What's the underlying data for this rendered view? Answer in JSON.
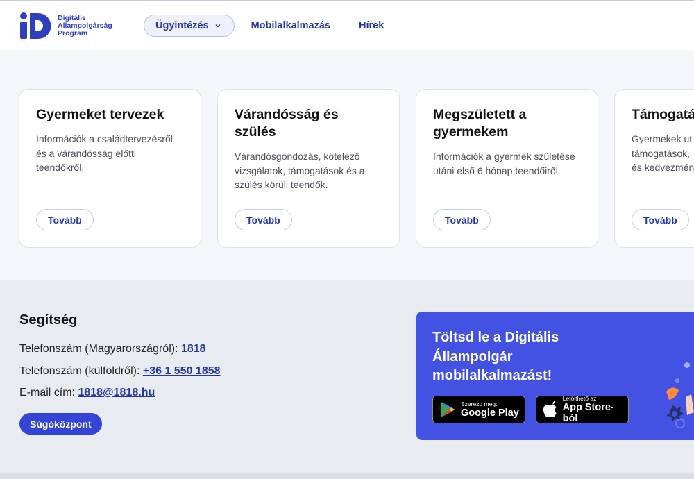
{
  "header": {
    "logo_lines": [
      "Digitális",
      "Állampolgárság",
      "Program"
    ],
    "nav": {
      "dropdown_label": "Ügyintézés",
      "links": [
        "Mobilalkalmazás",
        "Hírek"
      ]
    }
  },
  "cards": [
    {
      "title": "Gyermeket tervezek",
      "desc": "Információk a családtervezésről és a várandósság előtti teendőkről.",
      "button": "Tovább"
    },
    {
      "title": "Várandósság és szülés",
      "desc": "Várandósgondozás, kötelező vizsgálatok, támogatások és a szülés körüli teendők.",
      "button": "Tovább"
    },
    {
      "title": "Megszületett a gyermekem",
      "desc": "Információk a gyermek születése utáni első 6 hónap teendőiről.",
      "button": "Tovább"
    },
    {
      "title": "Támogatá",
      "desc": "Gyermekek ut támogatások, és kedvezmén",
      "button": "Tovább"
    }
  ],
  "help": {
    "title": "Segítség",
    "phone_hu_label": "Telefonszám (Magyarországról):",
    "phone_hu": "1818",
    "phone_abroad_label": "Telefonszám (külföldről):",
    "phone_abroad": "+36 1 550 1858",
    "email_label": "E-mail cím:",
    "email": "1818@1818.hu",
    "button": "Súgóközpont"
  },
  "promo": {
    "title": "Töltsd le a Digitális Állampolgár mobilalkalmazást!",
    "google_small": "Szerezd meg:",
    "google_big": "Google Play",
    "apple_small": "Letölthető az",
    "apple_big": "App Store-ból"
  },
  "colors": {
    "accent": "#2336a8",
    "primary_button": "#3344d6",
    "promo_bg": "#4452e3"
  }
}
